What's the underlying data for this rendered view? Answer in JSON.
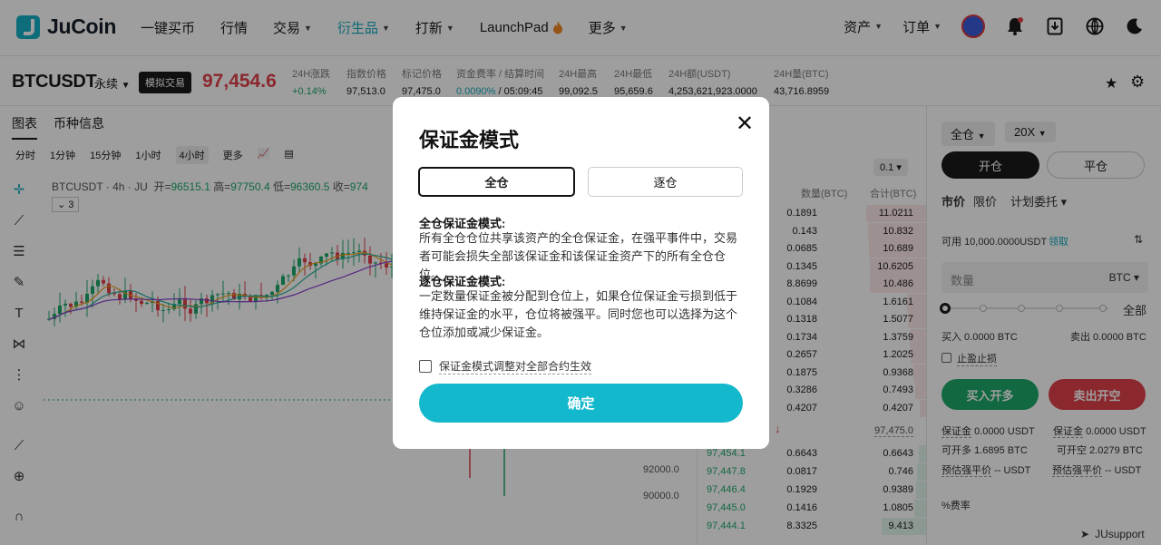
{
  "nav": {
    "brand": "JuCoin",
    "items": [
      {
        "label": "一键买币",
        "caret": false,
        "active": false
      },
      {
        "label": "行情",
        "caret": false,
        "active": false
      },
      {
        "label": "交易",
        "caret": true,
        "active": false
      },
      {
        "label": "衍生品",
        "caret": true,
        "active": true
      },
      {
        "label": "打新",
        "caret": true,
        "active": false
      },
      {
        "label": "LaunchPad",
        "caret": false,
        "active": false
      },
      {
        "label": "更多",
        "caret": true,
        "active": false
      }
    ],
    "launchpad_icon": "fire-icon",
    "right": {
      "assets": "资产",
      "orders": "订单"
    },
    "icons": [
      "avatar",
      "bell-icon",
      "download-icon",
      "globe-icon",
      "moon-icon"
    ]
  },
  "ticker": {
    "symbol": "BTCUSDT",
    "contract": "永续",
    "demo_badge": "模拟交易",
    "last_price": "97,454.6",
    "stats": [
      {
        "label": "24H涨跌",
        "value": "+0.14%",
        "tone": "green"
      },
      {
        "label": "指数价格",
        "value": "97,513.0",
        "tone": ""
      },
      {
        "label": "标记价格",
        "value": "97,475.0",
        "tone": ""
      },
      {
        "label": "资金费率 / 结算时间",
        "value": "0.0090%",
        "value2": " / 05:09:45",
        "tone": "teal"
      },
      {
        "label": "24H最高",
        "value": "99,092.5",
        "tone": ""
      },
      {
        "label": "24H最低",
        "value": "95,659.6",
        "tone": ""
      },
      {
        "label": "24H额(USDT)",
        "value": "4,253,621,923.0000",
        "tone": ""
      },
      {
        "label": "24H量(BTC)",
        "value": "43,716.8959",
        "tone": ""
      }
    ]
  },
  "chart": {
    "tabs": [
      "图表",
      "币种信息"
    ],
    "intervals": [
      "分时",
      "1分钟",
      "15分钟",
      "1小时",
      "4小时",
      "更多"
    ],
    "active_interval": "4小时",
    "legend": {
      "title": "BTCUSDT · 4h · JU",
      "open_label": "开=",
      "open": "96515.1",
      "high_label": "高=",
      "high": "97750.4",
      "low_label": "低=",
      "low": "96360.5",
      "close_label": "收=",
      "close": "974"
    },
    "indicator_count": "3",
    "axis": [
      "92000.0",
      "90000.0"
    ],
    "tools": [
      "crosshair-icon",
      "trend-line-icon",
      "fib-icon",
      "brush-icon",
      "text-icon",
      "pattern-icon",
      "measure-icon",
      "emoji-icon",
      "ruler-icon",
      "zoom-icon",
      "magnet-icon"
    ]
  },
  "orderbook": {
    "size_option": "0.1",
    "col_qty": "数量(BTC)",
    "col_total": "合计(BTC)",
    "asks": [
      {
        "q": "0.1891",
        "t": "11.0211",
        "w": 0.95
      },
      {
        "q": "0.143",
        "t": "10.832",
        "w": 0.92
      },
      {
        "q": "0.0685",
        "t": "10.689",
        "w": 0.9
      },
      {
        "q": "0.1345",
        "t": "10.6205",
        "w": 0.89
      },
      {
        "q": "8.8699",
        "t": "10.486",
        "w": 0.88
      },
      {
        "q": "0.1084",
        "t": "1.6161",
        "w": 0.3
      },
      {
        "q": "0.1318",
        "t": "1.5077",
        "w": 0.28
      },
      {
        "q": "0.1734",
        "t": "1.3759",
        "w": 0.26
      },
      {
        "q": "0.2657",
        "t": "1.2025",
        "w": 0.24
      },
      {
        "q": "0.1875",
        "t": "0.9368",
        "w": 0.2
      },
      {
        "q": "0.3286",
        "t": "0.7493",
        "w": 0.17
      },
      {
        "q": "0.4207",
        "t": "0.4207",
        "w": 0.1
      }
    ],
    "mid_mark": "97,475.0",
    "bids": [
      {
        "p": "97,454.1",
        "q": "0.6643",
        "t": "0.6643",
        "w": 0.12
      },
      {
        "p": "97,447.8",
        "q": "0.0817",
        "t": "0.746",
        "w": 0.14
      },
      {
        "p": "97,446.4",
        "q": "0.1929",
        "t": "0.9389",
        "w": 0.16
      },
      {
        "p": "97,445.0",
        "q": "0.1416",
        "t": "1.0805",
        "w": 0.18
      },
      {
        "p": "97,444.1",
        "q": "8.3325",
        "t": "9.413",
        "w": 0.7
      }
    ]
  },
  "order_panel": {
    "margin_mode": "全仓",
    "leverage": "20X",
    "open": "开仓",
    "close": "平仓",
    "types": [
      "市价",
      "限价",
      "计划委托"
    ],
    "available_label": "可用",
    "available_value": "10,000.0000USDT",
    "claim": "领取",
    "qty_placeholder": "数量",
    "qty_unit": "BTC",
    "all": "全部",
    "buy_amount": "买入 0.0000 BTC",
    "sell_amount": "卖出 0.0000 BTC",
    "tpsl": "止盈止损",
    "buy_btn": "买入开多",
    "sell_btn": "卖出开空",
    "buy_info": [
      {
        "label": "保证金",
        "value": "0.0000 USDT"
      },
      {
        "label": "可开多",
        "value": "1.6895  BTC"
      },
      {
        "label": "预估强平价",
        "value": "--   USDT"
      }
    ],
    "sell_info": [
      {
        "label": "保证金",
        "value": "0.0000 USDT"
      },
      {
        "label": "可开空",
        "value": "2.0279  BTC"
      },
      {
        "label": "预估强平价",
        "value": "--   USDT"
      }
    ],
    "fee": "费率"
  },
  "modal": {
    "title": "保证金模式",
    "option_cross": "全仓",
    "option_isolated": "逐仓",
    "cross_heading": "全仓保证金模式:",
    "cross_text": "所有全仓仓位共享该资产的全仓保证金，在强平事件中，交易者可能会损失全部该保证金和该保证金资产下的所有全仓仓位。",
    "isolated_heading": "逐仓保证金模式:",
    "isolated_text": "一定数量保证金被分配到仓位上，如果仓位保证金亏损到低于维持保证金的水平，仓位将被强平。同时您也可以选择为这个仓位添加或减少保证金。",
    "checkbox_label": "保证金模式调整对全部合约生效",
    "confirm": "确定"
  },
  "footer": {
    "support": "JUsupport"
  },
  "colors": {
    "accent": "#14b8cc",
    "up": "#1ea86a",
    "down": "#e0424a"
  }
}
